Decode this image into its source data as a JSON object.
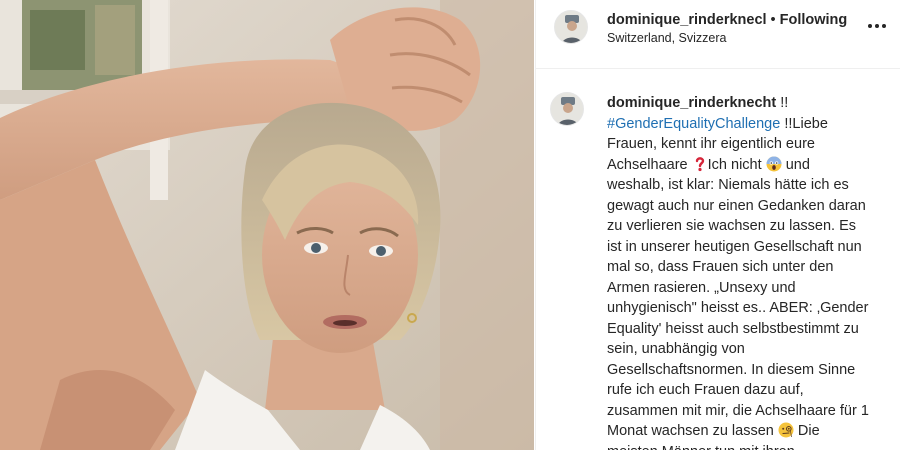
{
  "post": {
    "username": "dominique_rinderknecl",
    "separator": "•",
    "follow_state": "Following",
    "location": "Switzerland, Svizzera",
    "more_icon": "more-horizontal-icon"
  },
  "caption": {
    "username": "dominique_rinderknecht",
    "prefix": " !!",
    "hashtag": "#GenderEqualityChallenge",
    "text1": " !!Liebe Frauen, kennt ihr eigentlich eure Achselhaare ",
    "emoji1": "question-mark-emoji",
    "text2": "Ich nicht ",
    "emoji2": "screaming-face-emoji",
    "text3": " und weshalb, ist klar: Niemals hätte ich es gewagt auch nur einen Gedanken daran zu verlieren sie wachsen zu lassen. Es ist in unserer heutigen Gesellschaft nun mal so, dass Frauen sich unter den Armen rasieren. „Unsexy und unhygienisch\" heisst es.. ABER: ‚Gender Equality' heisst auch selbstbestimmt zu sein, unabhängig von Gesellschaftsnormen. In diesem Sinne rufe ich euch Frauen dazu auf, zusammen mit mir, die Achselhaare für 1 Monat wachsen zu lassen ",
    "emoji3": "face-with-monocle-emoji",
    "text4": " Die meisten Männer tun mit ihren"
  },
  "colors": {
    "hashtag": "#1f6fb2",
    "text": "#262626",
    "divider": "#efefef"
  }
}
